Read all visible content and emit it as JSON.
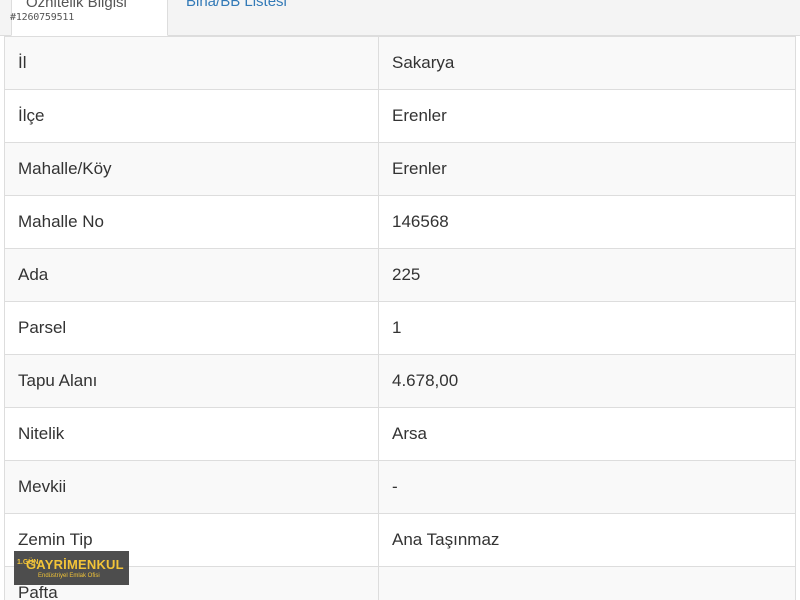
{
  "tabs": [
    {
      "label": "Öznitelik Bilgisi",
      "active": true
    },
    {
      "label": "Bina/BB Listesi",
      "active": false
    }
  ],
  "watermark_id": "#1260759511",
  "rows": [
    {
      "key": "İl",
      "value": "Sakarya"
    },
    {
      "key": "İlçe",
      "value": "Erenler"
    },
    {
      "key": "Mahalle/Köy",
      "value": "Erenler"
    },
    {
      "key": "Mahalle No",
      "value": "146568"
    },
    {
      "key": "Ada",
      "value": "225"
    },
    {
      "key": "Parsel",
      "value": "1"
    },
    {
      "key": "Tapu Alanı",
      "value": "4.678,00"
    },
    {
      "key": "Nitelik",
      "value": "Arsa"
    },
    {
      "key": "Mevkii",
      "value": "-"
    },
    {
      "key": "Zemin Tip",
      "value": "Ana Taşınmaz"
    },
    {
      "key": "Pafta",
      "value": ""
    }
  ],
  "logo": {
    "mark": "1.GÜN",
    "main": "GAYRİMENKUL",
    "sub": "Endüstriyel Emlak Ofisi"
  },
  "colors": {
    "link": "#337ab7",
    "border": "#dddddd",
    "stripe": "#f9f9f9",
    "logo_text": "#f2c028"
  }
}
